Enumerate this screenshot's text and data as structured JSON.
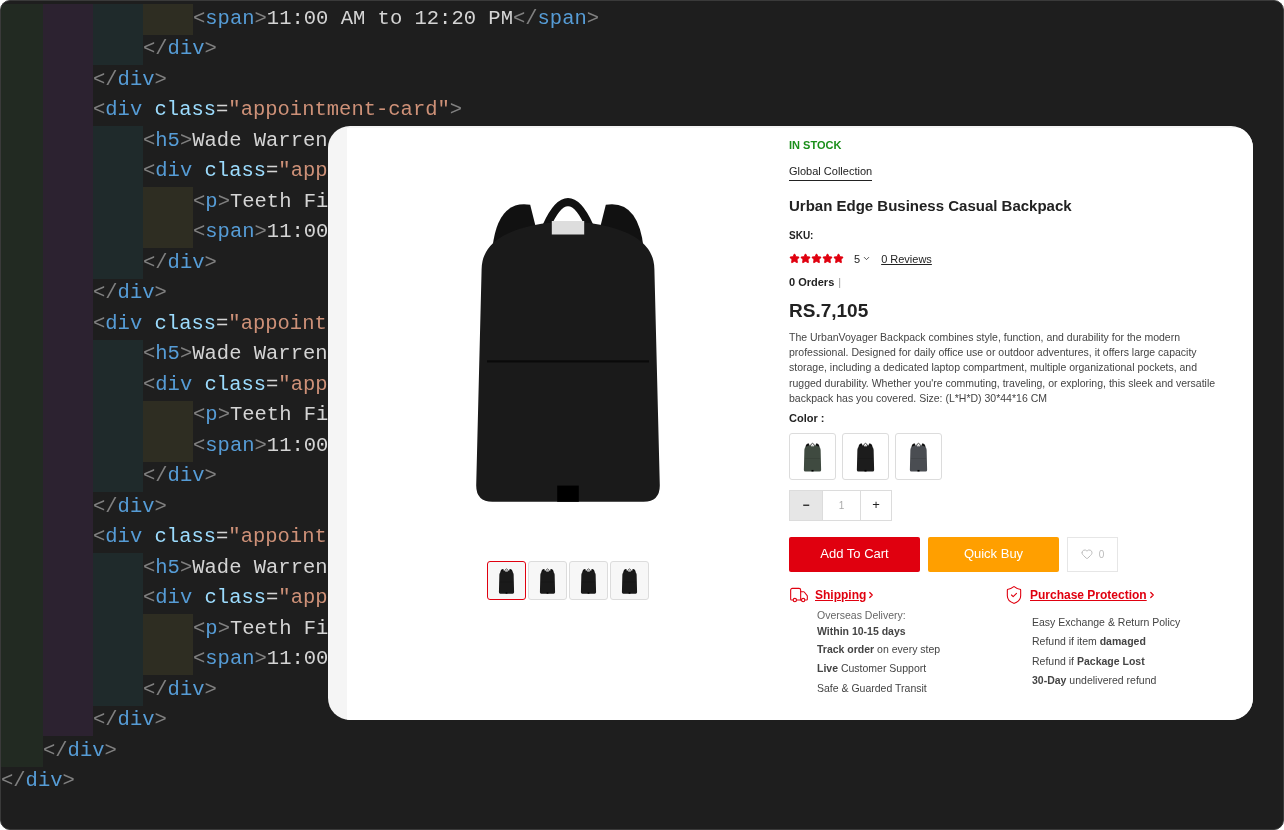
{
  "editor": {
    "code": [
      {
        "children": [
          {
            "children": [
              {
                "children": [
                  {
                    "children": [
                      {
                        "text": "<span>11:00 AM to 12:20 PM</span>"
                      }
                    ]
                  },
                  {
                    "text": "</div>"
                  }
                ]
              },
              {
                "text": "</div>"
              },
              {
                "text": "<div class=\"appointment-card\">",
                "children": [
                  {
                    "text": "<h5>Wade Warren"
                  },
                  {
                    "text": "<div class=\"app",
                    "children": [
                      {
                        "text": "<p>Teeth Fi"
                      },
                      {
                        "text": "<span>11:00"
                      }
                    ]
                  },
                  {
                    "text": "</div>"
                  }
                ]
              },
              {
                "text": "</div>"
              },
              {
                "text": "<div class=\"appoint",
                "children": [
                  {
                    "text": "<h5>Wade Warren"
                  },
                  {
                    "text": "<div class=\"app",
                    "children": [
                      {
                        "text": "<p>Teeth Fi"
                      },
                      {
                        "text": "<span>11:00"
                      }
                    ]
                  },
                  {
                    "text": "</div>"
                  }
                ]
              },
              {
                "text": "</div>"
              },
              {
                "text": "<div class=\"appoint",
                "children": [
                  {
                    "text": "<h5>Wade Warren"
                  },
                  {
                    "text": "<div class=\"app",
                    "children": [
                      {
                        "text": "<p>Teeth Fi"
                      },
                      {
                        "text": "<span>11:00"
                      }
                    ]
                  },
                  {
                    "text": "</div>"
                  }
                ]
              },
              {
                "text": "</div>"
              }
            ]
          },
          {
            "text": "</div>"
          }
        ]
      },
      {
        "text": "</div>"
      }
    ]
  },
  "product": {
    "thumbnails": [
      {
        "selected": true
      },
      {
        "selected": false
      },
      {
        "selected": false
      },
      {
        "selected": false
      }
    ],
    "stock": "IN STOCK",
    "collection": "Global Collection",
    "title": "Urban Edge Business Casual Backpack",
    "sku_label": "SKU:",
    "stars": 5,
    "rating": "5",
    "reviews": "0 Reviews",
    "orders": "0 Orders",
    "separator": "|",
    "price": "RS.7,105",
    "description": "The UrbanVoyager Backpack combines style, function, and durability for the modern professional. Designed for daily office use or outdoor adventures, it offers large capacity storage, including a dedicated laptop compartment, multiple organizational pockets, and rugged durability. Whether you're commuting, traveling, or exploring, this sleek and versatile backpack has you covered. Size: (L*H*D) 30*44*16 CM",
    "color_label": "Color :",
    "colors": [
      {
        "color": "#3f4a40"
      },
      {
        "color": "#1c1c1c"
      },
      {
        "color": "#4a4d52"
      }
    ],
    "quantity": {
      "minus": "−",
      "value": "1",
      "plus": "+"
    },
    "add_to_cart": "Add To Cart",
    "quick_buy": "Quick Buy",
    "wishlist_count": "0",
    "shipping": {
      "title": "Shipping",
      "delivery_label": "Overseas Delivery:",
      "delivery_time": "Within 10-15 days",
      "points": [
        "**Track order** on every step",
        "**Live** Customer Support",
        "Safe & Guarded Transit"
      ]
    },
    "protection": {
      "title": "Purchase Protection",
      "points": [
        "Easy Exchange & Return Policy",
        "Refund if item **damaged**",
        "Refund if **Package Lost**",
        "**30-Day** undelivered refund"
      ]
    }
  }
}
